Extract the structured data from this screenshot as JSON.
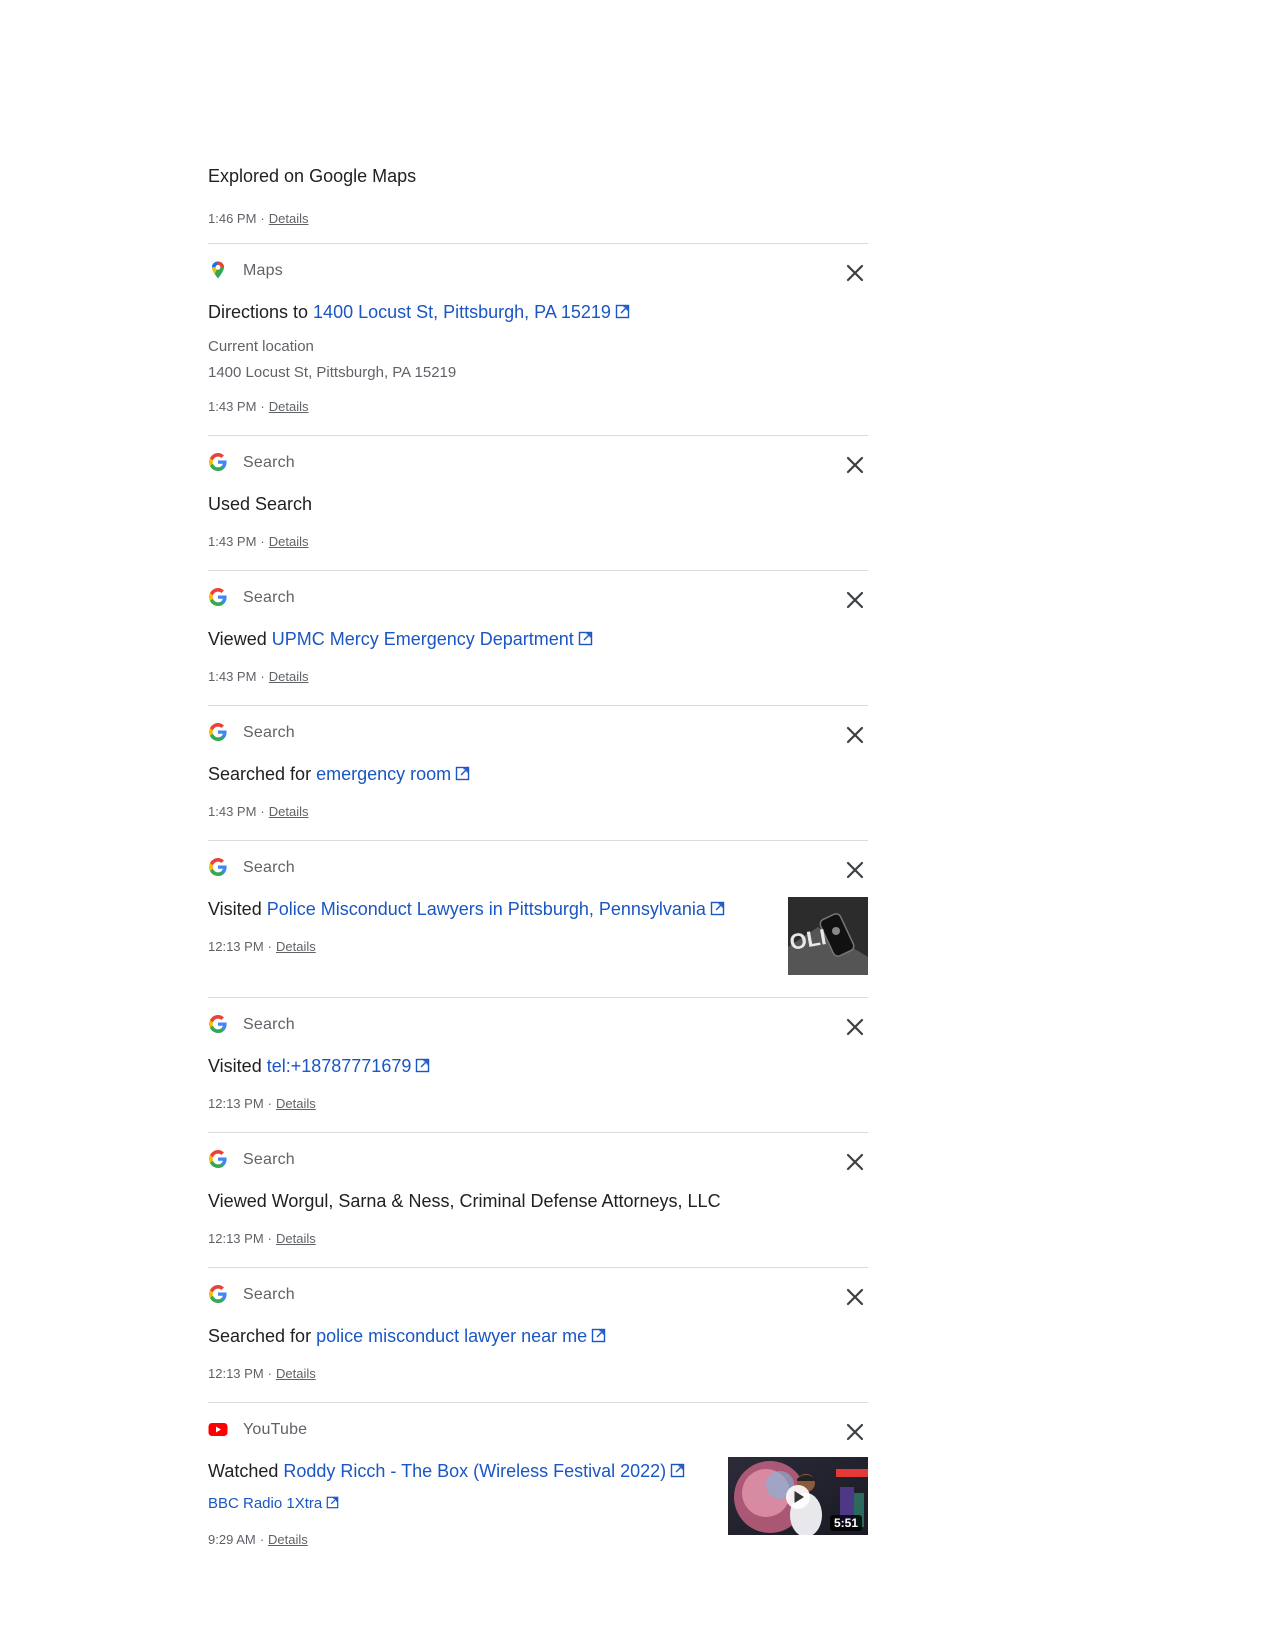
{
  "header": {
    "title": "Explored on Google Maps",
    "time": "1:46 PM",
    "details": "Details"
  },
  "separator": "·",
  "items": [
    {
      "product": "Maps",
      "icon": "maps-pin-icon",
      "prefix": "Directions to ",
      "link": "1400 Locust St, Pittsburgh, PA 15219",
      "sub1": "Current location",
      "sub2": "1400 Locust St, Pittsburgh, PA 15219",
      "time": "1:43 PM",
      "details": "Details"
    },
    {
      "product": "Search",
      "icon": "google-g-icon",
      "prefix": "Used Search",
      "time": "1:43 PM",
      "details": "Details"
    },
    {
      "product": "Search",
      "icon": "google-g-icon",
      "prefix": "Viewed ",
      "link": "UPMC Mercy Emergency Department",
      "time": "1:43 PM",
      "details": "Details"
    },
    {
      "product": "Search",
      "icon": "google-g-icon",
      "prefix": "Searched for ",
      "link": "emergency room",
      "time": "1:43 PM",
      "details": "Details"
    },
    {
      "product": "Search",
      "icon": "google-g-icon",
      "prefix": "Visited ",
      "link": "Police Misconduct Lawyers in Pittsburgh, Pennsylvania",
      "time": "12:13 PM",
      "details": "Details"
    },
    {
      "product": "Search",
      "icon": "google-g-icon",
      "prefix": "Visited ",
      "link": "tel:+18787771679",
      "time": "12:13 PM",
      "details": "Details"
    },
    {
      "product": "Search",
      "icon": "google-g-icon",
      "prefix": "Viewed Worgul, Sarna & Ness, Criminal Defense Attorneys, LLC",
      "time": "12:13 PM",
      "details": "Details"
    },
    {
      "product": "Search",
      "icon": "google-g-icon",
      "prefix": "Searched for ",
      "link": "police misconduct lawyer near me",
      "time": "12:13 PM",
      "details": "Details"
    },
    {
      "product": "YouTube",
      "icon": "youtube-icon",
      "prefix": "Watched ",
      "link": "Roddy Ricch - The Box (Wireless Festival 2022)",
      "channel": "BBC Radio 1Xtra",
      "duration": "5:51",
      "time": "9:29 AM",
      "details": "Details"
    }
  ],
  "colors": {
    "link": "#1a56c4",
    "meta": "#5f6368",
    "divider": "#dadce0",
    "youtube_red": "#ff0000"
  }
}
